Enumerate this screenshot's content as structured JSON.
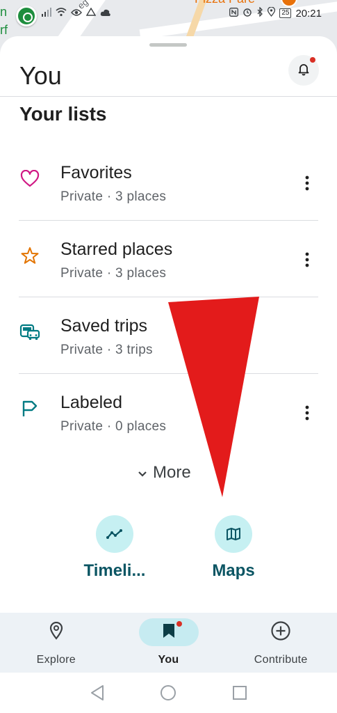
{
  "status_bar": {
    "time": "20:21",
    "battery": "25",
    "icons": [
      "signal-icon",
      "wifi-icon",
      "eye-icon",
      "drive-icon",
      "cloud-icon",
      "nfc-icon",
      "alarm-icon",
      "bluetooth-icon",
      "location-icon",
      "battery-icon"
    ]
  },
  "map": {
    "poi_text": "n\nrf",
    "street_label": "eg",
    "pizza_label": "Pizza Pare"
  },
  "header": {
    "title": "You",
    "bell_icon": "bell-icon",
    "has_notification": true
  },
  "lists": {
    "heading": "Your lists",
    "items": [
      {
        "title": "Favorites",
        "subtitle": "Private · 3 places",
        "icon": "heart-icon",
        "color": "#d01884",
        "has_menu": true
      },
      {
        "title": "Starred places",
        "subtitle": "Private · 3 places",
        "icon": "star-icon",
        "color": "#e37400",
        "has_menu": true
      },
      {
        "title": "Saved trips",
        "subtitle": "Private · 3 trips",
        "icon": "bus-car-icon",
        "color": "#007b83",
        "has_menu": false
      },
      {
        "title": "Labeled",
        "subtitle": "Private · 0 places",
        "icon": "flag-icon",
        "color": "#007b83",
        "has_menu": true
      }
    ],
    "more_label": "More"
  },
  "quick_actions": {
    "timeline_label": "Timeli...",
    "maps_label": "Maps"
  },
  "bottom_nav": {
    "explore_label": "Explore",
    "you_label": "You",
    "contribute_label": "Contribute",
    "active": "you"
  },
  "colors": {
    "accent_teal": "#0b5563",
    "pill_bg": "#c6ebf1",
    "annotation_red": "#e31b1b",
    "notification_dot": "#d93025"
  }
}
